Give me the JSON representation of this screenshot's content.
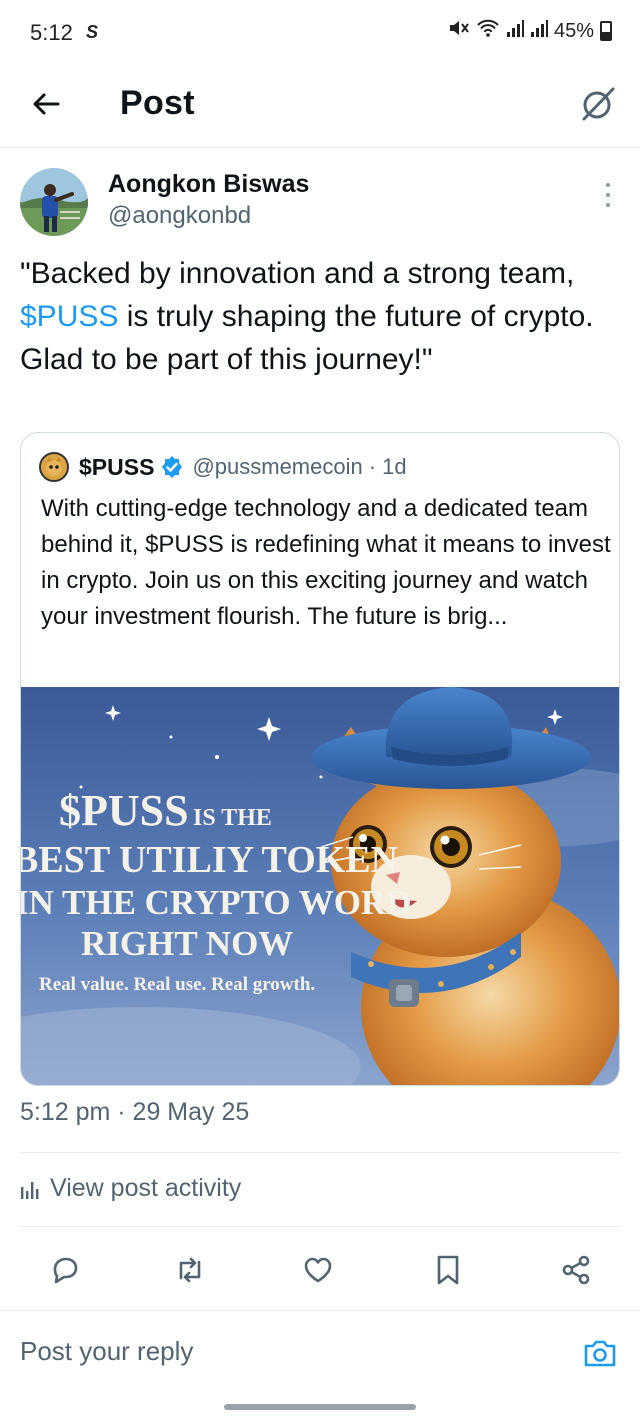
{
  "status_bar": {
    "time": "5:12",
    "app_indicator": "S",
    "battery": "45%",
    "icons": [
      "mute-icon",
      "wifi-icon",
      "signal-icon",
      "signal-icon",
      "battery-icon"
    ]
  },
  "header": {
    "title": "Post",
    "back_icon": "arrow-left-icon",
    "grok_icon": "grok-icon"
  },
  "post": {
    "author_name": "Aongkon Biswas",
    "author_handle": "@aongkonbd",
    "text_part1": "\"Backed by innovation and a strong team, ",
    "cashtag": "$PUSS",
    "text_part2": " is truly shaping the future of crypto. Glad to be part of this journey!\"",
    "timestamp": "5:12 pm · 29 May 25",
    "activity_label": "View post activity"
  },
  "quote": {
    "name": "$PUSS",
    "handle": "@pussmemecoin",
    "age": "· 1d",
    "text": "With cutting-edge technology and a dedicated team behind it, $PUSS  is redefining what it means to invest in crypto. Join us on this exciting journey and watch your investment flourish. The future is brig...",
    "image": {
      "line1": "$PUSS",
      "line1_small": "IS THE",
      "line2": "BEST UTILIY TOKEN",
      "line3": "IN THE CRYPTO WORD",
      "line4": "RIGHT NOW",
      "tagline": "Real value. Real use. Real growth."
    }
  },
  "actions": [
    "reply-icon",
    "repost-icon",
    "like-icon",
    "bookmark-icon",
    "share-icon"
  ],
  "reply": {
    "placeholder": "Post your reply"
  },
  "colors": {
    "accent": "#1d9bf0",
    "text": "#0f1419",
    "secondary": "#536471",
    "border": "#cfd9de"
  }
}
